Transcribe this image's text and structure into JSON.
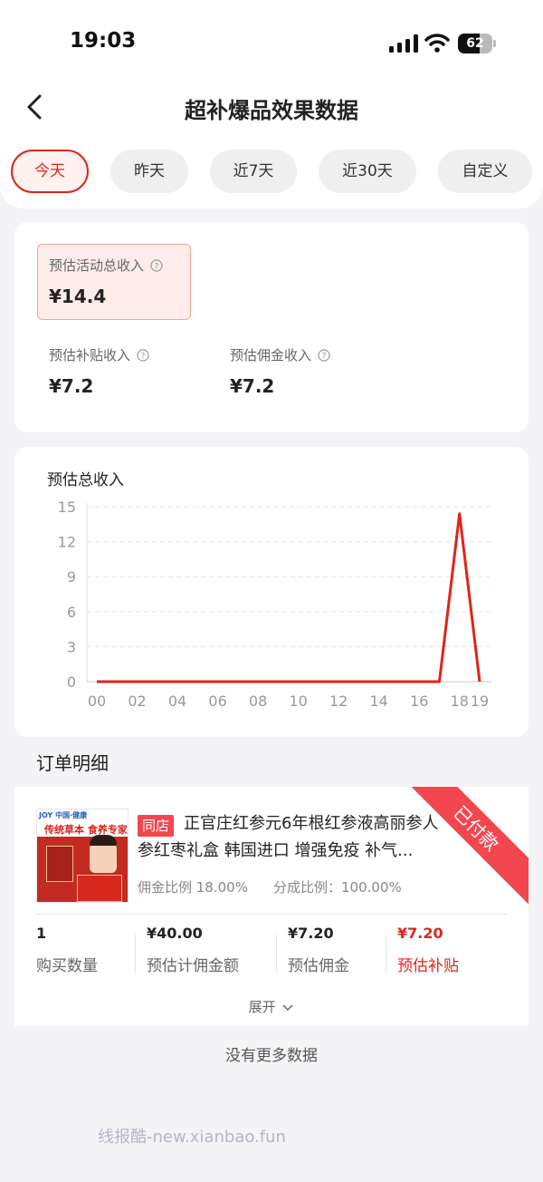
{
  "status_bar": {
    "time": "19:03",
    "battery": "62",
    "battery_level": 0.62
  },
  "header": {
    "title": "超补爆品效果数据"
  },
  "tabs": [
    {
      "label": "今天",
      "active": true
    },
    {
      "label": "昨天",
      "active": false
    },
    {
      "label": "近7天",
      "active": false
    },
    {
      "label": "近30天",
      "active": false
    },
    {
      "label": "自定义",
      "active": false
    }
  ],
  "summary": {
    "total": {
      "label": "预估活动总收入",
      "value": "¥14.4"
    },
    "subsidy": {
      "label": "预估补贴收入",
      "value": "¥7.2"
    },
    "commission": {
      "label": "预估佣金收入",
      "value": "¥7.2"
    }
  },
  "chart_data": {
    "type": "line",
    "title": "预估总收入",
    "x": [
      "00",
      "01",
      "02",
      "03",
      "04",
      "05",
      "06",
      "07",
      "08",
      "09",
      "10",
      "11",
      "12",
      "13",
      "14",
      "15",
      "16",
      "17",
      "18",
      "19"
    ],
    "x_tick_labels": [
      "00",
      "02",
      "04",
      "06",
      "08",
      "10",
      "12",
      "14",
      "16",
      "18",
      "19"
    ],
    "series": [
      {
        "values": [
          0,
          0,
          0,
          0,
          0,
          0,
          0,
          0,
          0,
          0,
          0,
          0,
          0,
          0,
          0,
          0,
          0,
          0,
          14.4,
          0
        ]
      }
    ],
    "ylim": [
      0,
      15
    ],
    "y_ticks": [
      0,
      3,
      6,
      9,
      12,
      15
    ],
    "grid": true,
    "line_color": "#e0241a"
  },
  "orders": {
    "section_title": "订单明细",
    "item": {
      "status_ribbon": "已付款",
      "store_tag": "同店",
      "product_name": "正官庄红参元6年根红参液高丽参人参红枣礼盒 韩国进口 增强免疫 补气...",
      "thumb": {
        "brand": "JOY 中国·健康",
        "slogan": "传统草本 食养专家"
      },
      "commission_ratio": "佣金比例 18.00%",
      "split_ratio": "分成比例：100.00%",
      "stats": [
        {
          "value": "1",
          "label": "购买数量"
        },
        {
          "value": "¥40.00",
          "label": "预估计佣金额"
        },
        {
          "value": "¥7.20",
          "label": "预估佣金"
        },
        {
          "value": "¥7.20",
          "label": "预估补贴"
        }
      ],
      "expand_label": "展开"
    },
    "no_more": "没有更多数据"
  },
  "watermark": "线报酷-new.xianbao.fun",
  "colors": {
    "accent": "#e0241a",
    "ribbon": "#f4464e",
    "background": "#f4f4f7"
  },
  "icons": [
    "back-arrow-icon",
    "signal-icon",
    "wifi-icon",
    "battery-icon",
    "help-icon",
    "chevron-down-icon"
  ]
}
